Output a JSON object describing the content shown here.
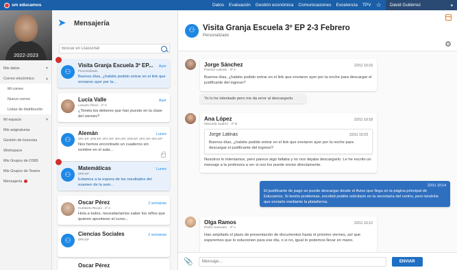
{
  "topbar": {
    "brand": "sm educamos",
    "nav": [
      "Datos",
      "Evaluación",
      "Gestión económica",
      "Comunicaciones",
      "Excelencia",
      "TPV"
    ],
    "star_icon": "star-outline-icon",
    "user": "David Gutiérrez",
    "user_caret": "▾"
  },
  "sidebar": {
    "year": "2022-2023",
    "items": [
      {
        "label": "Mis datos",
        "caret": "▾"
      },
      {
        "label": "Correo electrónico",
        "caret": "▴"
      },
      {
        "label": "Mi correo"
      },
      {
        "label": "Nuevo correo"
      },
      {
        "label": "Listas de distribución"
      },
      {
        "label": "Mi espacio",
        "caret": "▾"
      },
      {
        "label": "Mis asignaturas"
      },
      {
        "label": "Gestión de licencias"
      },
      {
        "label": "Workspace"
      },
      {
        "label": "Mis Grupos de O365"
      },
      {
        "label": "Mis Grupos de Teams"
      },
      {
        "label": "Mensajería"
      }
    ]
  },
  "conversations": {
    "title": "Mensajería",
    "search_placeholder": "Buscar en Classchat",
    "items": [
      {
        "name": "Visita Granja Escuela 3º EP...",
        "date": "Ayer",
        "sub": "Personalizado",
        "text": "Buenos días, ¿habéis podido entrar en el link que enviaron ayer por la..."
      },
      {
        "name": "Lucía Valle",
        "date": "Ayer",
        "sub": "Leandro Pérez · 2º C",
        "text": "¿Tenéis los deberes que han puesto en la clase del viernes?"
      },
      {
        "name": "Alemán",
        "date": "Lunes",
        "sub": "2PA-EP, 2PB-EP, 2PC-EP, 4PA-EP, 4PB-EP, 4PC-EP, 6PA-EP",
        "text": "Nos hemos encontrado un cuaderno sin nombre en el aula..."
      },
      {
        "name": "Matemáticas",
        "date": "Lunes",
        "sub": "5PE-EP",
        "text": "Estamos a la espera de los resultados del examen de la sem..."
      },
      {
        "name": "Oscar Pérez",
        "date": "2 semanas",
        "sub": "Humberto Rivoiro · 4º A",
        "text": "Hola a todos, necesitaríamos saber los niños que quieren apuntarse al curso..."
      },
      {
        "name": "Ciencias Sociales",
        "date": "2 semanas",
        "sub": "5PE-EP",
        "text": ""
      },
      {
        "name": "Oscar Pérez",
        "date": "",
        "sub": "",
        "text": ""
      }
    ]
  },
  "chat": {
    "title": "Visita Granja Escuela 3º EP 2-3 Febrero",
    "subtitle": "Personalizado",
    "messages": [
      {
        "name": "Jorge Sánchez",
        "sub": "Pancho Latinas · 3º A",
        "time": "22/11 10:23",
        "text": "Buenos días, ¿habéis podido entrar en el link que enviaron ayer por la noche para descargar el justificante del ingreso?"
      },
      {
        "text": "Yo lo he intentado pero me da error al descargarlo."
      },
      {
        "name": "Ana López",
        "sub": "Manuela Suárez · 3º B",
        "time": "22/11 10:18",
        "quote": {
          "name": "Jorge Latinas",
          "time": "22/11 10:23",
          "text": "Buenos días, ¿habéis podido entrar en el link que enviaron ayer por la noche para descargar el justificante del ingreso?"
        },
        "text": "Nosotros lo intentamos, pero parece algo fallaba y no nos dejaba descargarlo. Le he escrito un mensaje a la profesora a ver si nos los puede enviar directamente."
      },
      {
        "time": "22/11 10:14",
        "text": "El justificante de pago se puede descargar desde el Aviso que llega en la página principal de Educamos. Si tenéis problemas, escribid podéis solicitarlo en la secretaría del centro, pero tendréis que enviarlo mediante la plataforma."
      },
      {
        "name": "Olga Ramos",
        "sub": "Pedro Samuelo · 3º A",
        "time": "22/11 10:12",
        "text": "Han ampliado el plazo de presentación de documentos hasta el próximo viernes, así que esperemos que lo solucionen para ese día, o si no, igual lo podemos llevar en mano."
      }
    ],
    "composer_placeholder": "Mensaje...",
    "send_label": "ENVIAR"
  },
  "colors": {
    "topbar": "#1a5fa8",
    "accent": "#1e88e5",
    "unread": "#d32f2f",
    "own_message": "#2f6fbf"
  }
}
